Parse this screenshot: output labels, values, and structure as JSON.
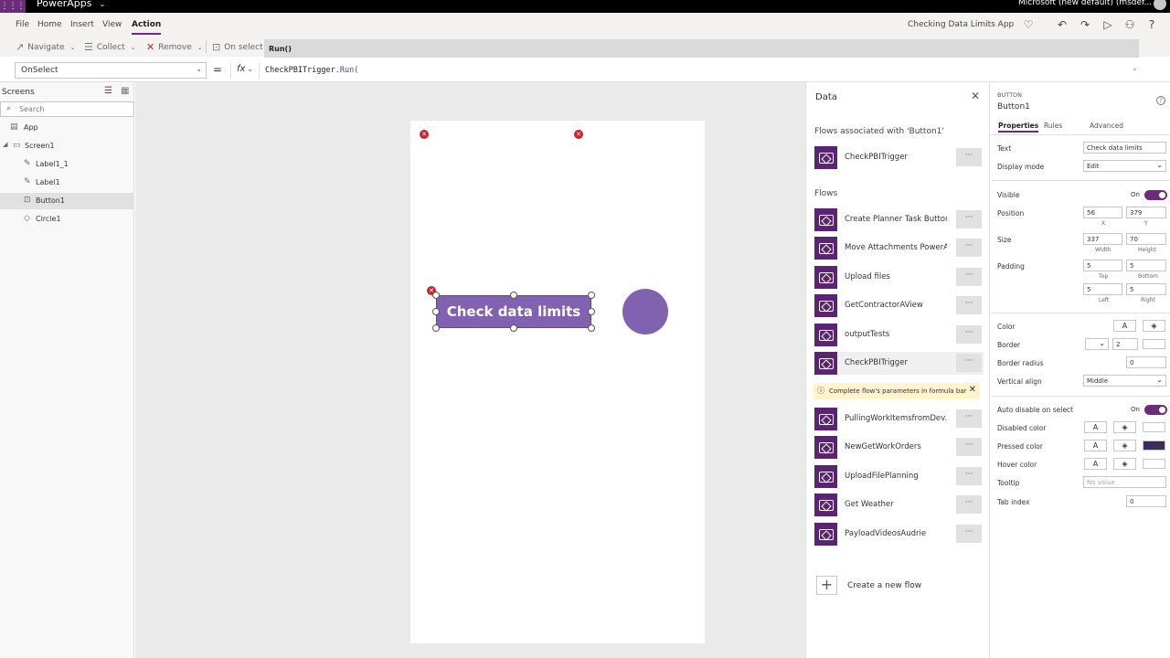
{
  "titlebar": {
    "app_name": "PowerApps",
    "environment": "Microsoft (new default) (msdef..."
  },
  "menu": {
    "items": [
      "File",
      "Home",
      "Insert",
      "View",
      "Action"
    ],
    "active": "Action",
    "app_title": "Checking Data Limits App"
  },
  "ribbon": {
    "navigate": "Navigate",
    "collect": "Collect",
    "remove": "Remove",
    "on_select": "On select",
    "run_tip": "Run()"
  },
  "formula_bar": {
    "property": "OnSelect",
    "equals": "=",
    "fx": "fx",
    "formula_fn": "CheckPBITrigger",
    "formula_rest": ".Run("
  },
  "tree": {
    "title": "Screens",
    "search_placeholder": "Search",
    "items": [
      {
        "label": "App"
      },
      {
        "label": "Screen1"
      },
      {
        "label": "Label1_1"
      },
      {
        "label": "Label1"
      },
      {
        "label": "Button1"
      },
      {
        "label": "Circle1"
      }
    ]
  },
  "canvas": {
    "button_text": "Check data limits",
    "colors": {
      "button": "#8062b0",
      "circle": "#8062b0"
    }
  },
  "data_pane": {
    "title": "Data",
    "assoc_header": "Flows associated with 'Button1'",
    "assoc_flows": [
      "CheckPBITrigger"
    ],
    "flows_header": "Flows",
    "flows": [
      "Create Planner Task Button",
      "Move Attachments PowerA...",
      "Upload files",
      "GetContractorAView",
      "outputTests",
      "CheckPBITrigger",
      "PullingWorkItemsfromDev...",
      "NewGetWorkOrders",
      "UploadFilePlanning",
      "Get Weather",
      "PayloadVideosAudrie"
    ],
    "more": "···",
    "warning": "Complete flow's parameters in formula bar",
    "new_flow": "Create a new flow"
  },
  "properties": {
    "kind": "BUTTON",
    "name": "Button1",
    "tabs": [
      "Properties",
      "Rules",
      "Advanced"
    ],
    "text_label": "Text",
    "text_value": "Check data limits",
    "display_mode_label": "Display mode",
    "display_mode": "Edit",
    "visible_label": "Visible",
    "visible_on": "On",
    "position_label": "Position",
    "x": "56",
    "y": "379",
    "x_label": "X",
    "y_label": "Y",
    "size_label": "Size",
    "width": "337",
    "height": "70",
    "width_label": "Width",
    "height_label": "Height",
    "padding_label": "Padding",
    "pad_top": "5",
    "pad_bottom": "5",
    "pad_left": "5",
    "pad_right": "5",
    "top_label": "Top",
    "bottom_label": "Bottom",
    "left_label": "Left",
    "right_label": "Right",
    "color_label": "Color",
    "border_label": "Border",
    "border_value": "2",
    "radius_label": "Border radius",
    "radius_value": "0",
    "valign_label": "Vertical align",
    "valign_value": "Middle",
    "autodisable_label": "Auto disable on select",
    "autodisable_on": "On",
    "disabled_color_label": "Disabled color",
    "pressed_color_label": "Pressed color",
    "hover_color_label": "Hover color",
    "tooltip_label": "Tooltip",
    "tooltip_placeholder": "No value",
    "tabindex_label": "Tab index",
    "tabindex_value": "0",
    "font_glyph": "A",
    "colors": {
      "accent": "#6b2c7a",
      "pressed_swatch": "#3e2b5e"
    }
  }
}
